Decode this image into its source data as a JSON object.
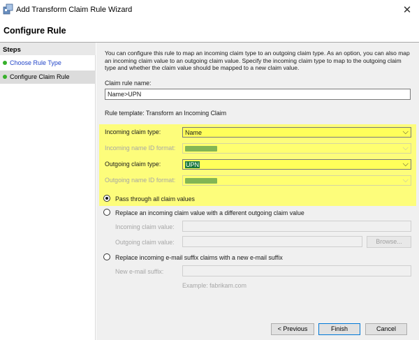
{
  "window": {
    "title": "Add Transform Claim Rule Wizard",
    "close_glyph": "✕"
  },
  "header": {
    "title": "Configure Rule"
  },
  "sidebar": {
    "heading": "Steps",
    "items": [
      {
        "label": "Choose Rule Type"
      },
      {
        "label": "Configure Claim Rule"
      }
    ]
  },
  "main": {
    "description": "You can configure this rule to map an incoming claim type to an outgoing claim type. As an option, you can also map an incoming claim value to an outgoing claim value. Specify the incoming claim type to map to the outgoing claim type and whether the claim value should be mapped to a new claim value.",
    "rule_name_label": "Claim rule name:",
    "rule_name_value": "Name>UPN",
    "rule_template": "Rule template: Transform an Incoming Claim",
    "incoming_claim_type_label": "Incoming claim type:",
    "incoming_claim_type_value": "Name",
    "incoming_name_id_label": "Incoming name ID format:",
    "outgoing_claim_type_label": "Outgoing claim type:",
    "outgoing_claim_type_value": "UPN",
    "outgoing_name_id_label": "Outgoing name ID format:",
    "radio_pass_through": "Pass through all claim values",
    "radio_replace_value": "Replace an incoming claim value with a different outgoing claim value",
    "incoming_claim_value_label": "Incoming claim value:",
    "outgoing_claim_value_label": "Outgoing claim value:",
    "browse_button": "Browse...",
    "radio_replace_suffix": "Replace incoming e-mail suffix claims with a new e-mail suffix",
    "new_suffix_label": "New e-mail suffix:",
    "suffix_example": "Example: fabrikam.com"
  },
  "footer": {
    "previous": "< Previous",
    "finish": "Finish",
    "cancel": "Cancel"
  },
  "colors": {
    "highlight": "#ffff66",
    "step_dot": "#36b02a",
    "link": "#2245c8"
  }
}
